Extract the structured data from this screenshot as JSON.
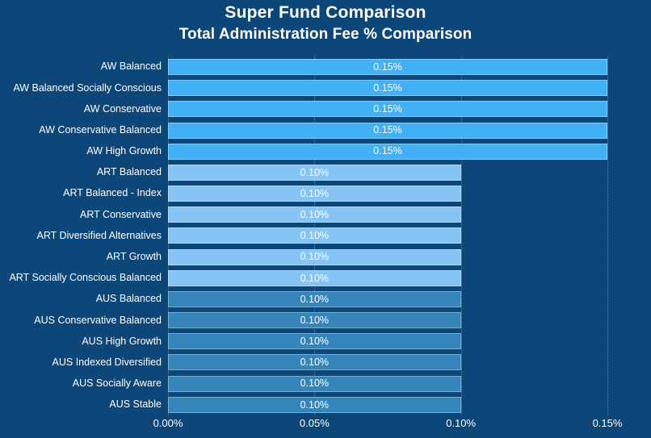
{
  "chart_data": {
    "type": "bar",
    "orientation": "horizontal",
    "title": "Super Fund Comparison",
    "subtitle": "Total Administration Fee % Comparison",
    "xlabel": "",
    "ylabel": "",
    "xlim": [
      0,
      0.15
    ],
    "xticks": [
      "0.00%",
      "0.05%",
      "0.10%",
      "0.15%"
    ],
    "xtick_values": [
      0,
      0.05,
      0.1,
      0.15
    ],
    "grid": true,
    "legend": "none",
    "background_color": "#0d4679",
    "text_color": "#ffffff",
    "gridline_color": "#6b9dc4",
    "categories": [
      "AW Balanced",
      "AW Balanced Socially Conscious",
      "AW Conservative",
      "AW Conservative Balanced",
      "AW High Growth",
      "ART Balanced",
      "ART Balanced - Index",
      "ART Conservative",
      "ART Diversified Alternatives",
      "ART Growth",
      "ART Socially Conscious Balanced",
      "AUS Balanced",
      "AUS Conservative Balanced",
      "AUS High Growth",
      "AUS Indexed Diversified",
      "AUS Socially Aware",
      "AUS Stable"
    ],
    "values": [
      0.15,
      0.15,
      0.15,
      0.15,
      0.15,
      0.1,
      0.1,
      0.1,
      0.1,
      0.1,
      0.1,
      0.1,
      0.1,
      0.1,
      0.1,
      0.1,
      0.1
    ],
    "data_labels": [
      "0.15%",
      "0.15%",
      "0.15%",
      "0.15%",
      "0.15%",
      "0.10%",
      "0.10%",
      "0.10%",
      "0.10%",
      "0.10%",
      "0.10%",
      "0.10%",
      "0.10%",
      "0.10%",
      "0.10%",
      "0.10%",
      "0.10%"
    ],
    "bar_colors": [
      "#42b0f5",
      "#42b0f5",
      "#42b0f5",
      "#42b0f5",
      "#42b0f5",
      "#85c4f5",
      "#85c4f5",
      "#85c4f5",
      "#85c4f5",
      "#85c4f5",
      "#85c4f5",
      "#3585bb",
      "#3585bb",
      "#3585bb",
      "#3585bb",
      "#3585bb",
      "#3585bb"
    ],
    "groups": [
      {
        "name": "AW",
        "color": "#42b0f5",
        "value": 0.15,
        "count": 5
      },
      {
        "name": "ART",
        "color": "#85c4f5",
        "value": 0.1,
        "count": 6
      },
      {
        "name": "AUS",
        "color": "#3585bb",
        "value": 0.1,
        "count": 6
      }
    ]
  }
}
